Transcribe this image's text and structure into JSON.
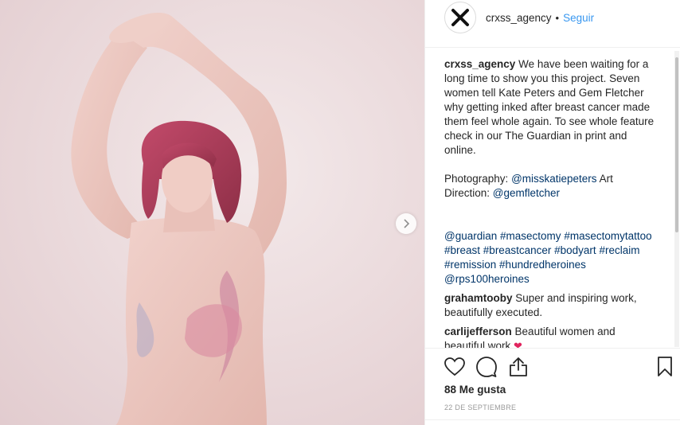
{
  "header": {
    "username": "crxss_agency",
    "separator": "•",
    "follow_label": "Seguir"
  },
  "caption": {
    "username": "crxss_agency",
    "text": " We have been waiting for a long time to show you this project. Seven women tell Kate Peters and Gem Fletcher why getting inked after breast cancer made them feel whole again. To see whole feature check in our The Guardian in print and online.",
    "credits_prefix": "Photography: ",
    "photographer": "@misskatiepeters",
    "credits_middle": " Art Direction: ",
    "art_director": "@gemfletcher",
    "tags": [
      "@guardian",
      "#masectomy",
      "#masectomytattoo",
      "#breast",
      "#breastcancer",
      "#bodyart",
      "#reclaim",
      "#remission",
      "#hundredheroines",
      "@rps100heroines"
    ]
  },
  "comments": [
    {
      "username": "grahamtooby",
      "text": " Super and inspiring work, beautifully executed."
    },
    {
      "username": "carlijefferson",
      "text": " Beautiful women and beautiful work ",
      "emoji": "❤"
    }
  ],
  "likes": "88 Me gusta",
  "date": "22 DE SEPTIEMBRE",
  "icons": {
    "avatar": "x-logo-icon",
    "next": "chevron-right-icon",
    "like": "heart-icon",
    "comment": "comment-bubble-icon",
    "share": "share-icon",
    "save": "bookmark-icon"
  },
  "colors": {
    "link": "#003569",
    "follow": "#3897f0",
    "text": "#262626",
    "muted": "#999999"
  }
}
